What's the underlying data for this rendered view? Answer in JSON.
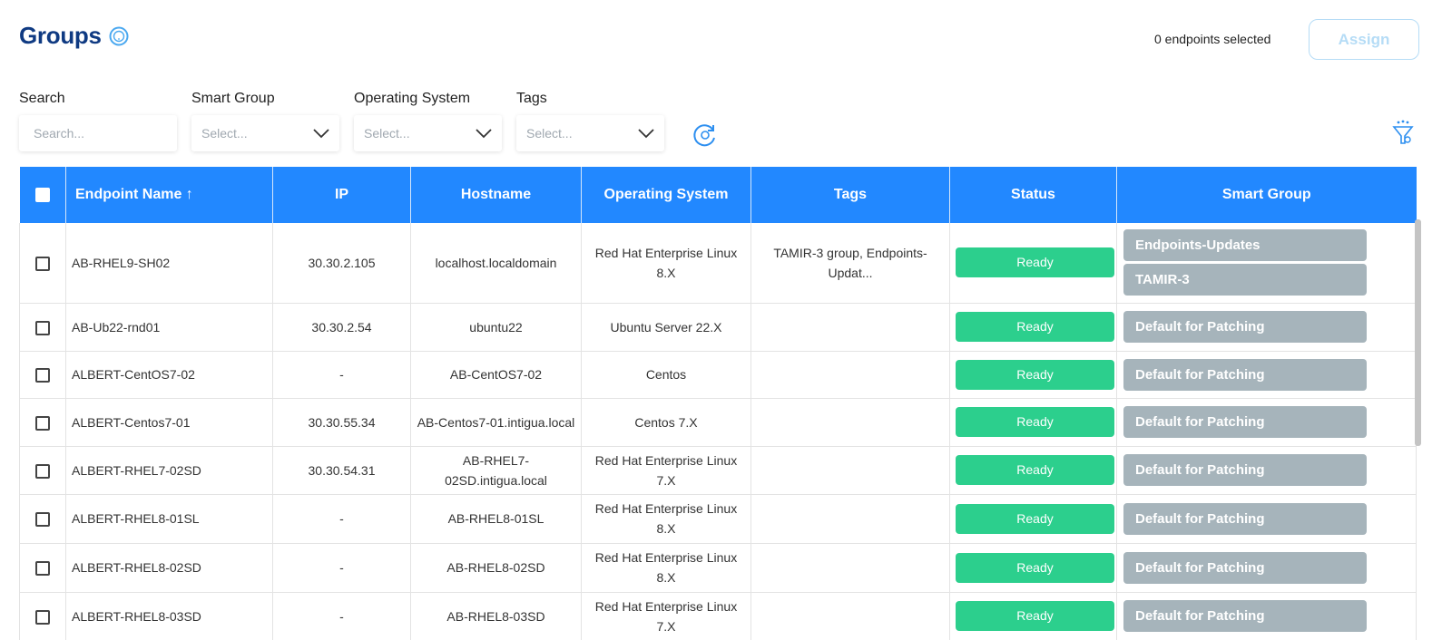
{
  "header": {
    "title": "Groups",
    "selected_count": "0 endpoints selected",
    "assign_label": "Assign"
  },
  "filters": {
    "search_label": "Search",
    "search_placeholder": "Search...",
    "smart_group_label": "Smart Group",
    "smart_group_value": "Select...",
    "os_label": "Operating System",
    "os_value": "Select...",
    "tags_label": "Tags",
    "tags_value": "Select..."
  },
  "table": {
    "columns": [
      "Endpoint Name ↑",
      "IP",
      "Hostname",
      "Operating System",
      "Tags",
      "Status",
      "Smart Group"
    ],
    "rows": [
      {
        "name": "AB-RHEL9-SH02",
        "ip": "30.30.2.105",
        "hostname": "localhost.localdomain",
        "os": "Red Hat Enterprise Linux 8.X",
        "tags": "TAMIR-3 group, Endpoints-Updat...",
        "status": "Ready",
        "smart_groups": [
          "Endpoints-Updates",
          "TAMIR-3"
        ]
      },
      {
        "name": "AB-Ub22-rnd01",
        "ip": "30.30.2.54",
        "hostname": "ubuntu22",
        "os": "Ubuntu Server 22.X",
        "tags": "",
        "status": "Ready",
        "smart_groups": [
          "Default for Patching"
        ]
      },
      {
        "name": "ALBERT-CentOS7-02",
        "ip": "-",
        "hostname": "AB-CentOS7-02",
        "os": "Centos",
        "tags": "",
        "status": "Ready",
        "smart_groups": [
          "Default for Patching"
        ]
      },
      {
        "name": "ALBERT-Centos7-01",
        "ip": "30.30.55.34",
        "hostname": "AB-Centos7-01.intigua.local",
        "os": "Centos 7.X",
        "tags": "",
        "status": "Ready",
        "smart_groups": [
          "Default for Patching"
        ]
      },
      {
        "name": "ALBERT-RHEL7-02SD",
        "ip": "30.30.54.31",
        "hostname": "AB-RHEL7-02SD.intigua.local",
        "os": "Red Hat Enterprise Linux 7.X",
        "tags": "",
        "status": "Ready",
        "smart_groups": [
          "Default for Patching"
        ]
      },
      {
        "name": "ALBERT-RHEL8-01SL",
        "ip": "-",
        "hostname": "AB-RHEL8-01SL",
        "os": "Red Hat Enterprise Linux 8.X",
        "tags": "",
        "status": "Ready",
        "smart_groups": [
          "Default for Patching"
        ]
      },
      {
        "name": "ALBERT-RHEL8-02SD",
        "ip": "-",
        "hostname": "AB-RHEL8-02SD",
        "os": "Red Hat Enterprise Linux 8.X",
        "tags": "",
        "status": "Ready",
        "smart_groups": [
          "Default for Patching"
        ]
      },
      {
        "name": "ALBERT-RHEL8-03SD",
        "ip": "-",
        "hostname": "AB-RHEL8-03SD",
        "os": "Red Hat Enterprise Linux 7.X",
        "tags": "",
        "status": "Ready",
        "smart_groups": [
          "Default for Patching"
        ]
      }
    ]
  },
  "colors": {
    "title": "#0f3a82",
    "header_bg": "#2288ff",
    "status_ready": "#2ccf8d",
    "smart_group_badge": "#a6b4bb",
    "assign_disabled": "#b5dcf6"
  },
  "icons": {
    "help": "help-circle-icon",
    "refresh": "refresh-icon",
    "filter": "filter-funnel-icon",
    "dropdown": "chevron-down-icon"
  }
}
